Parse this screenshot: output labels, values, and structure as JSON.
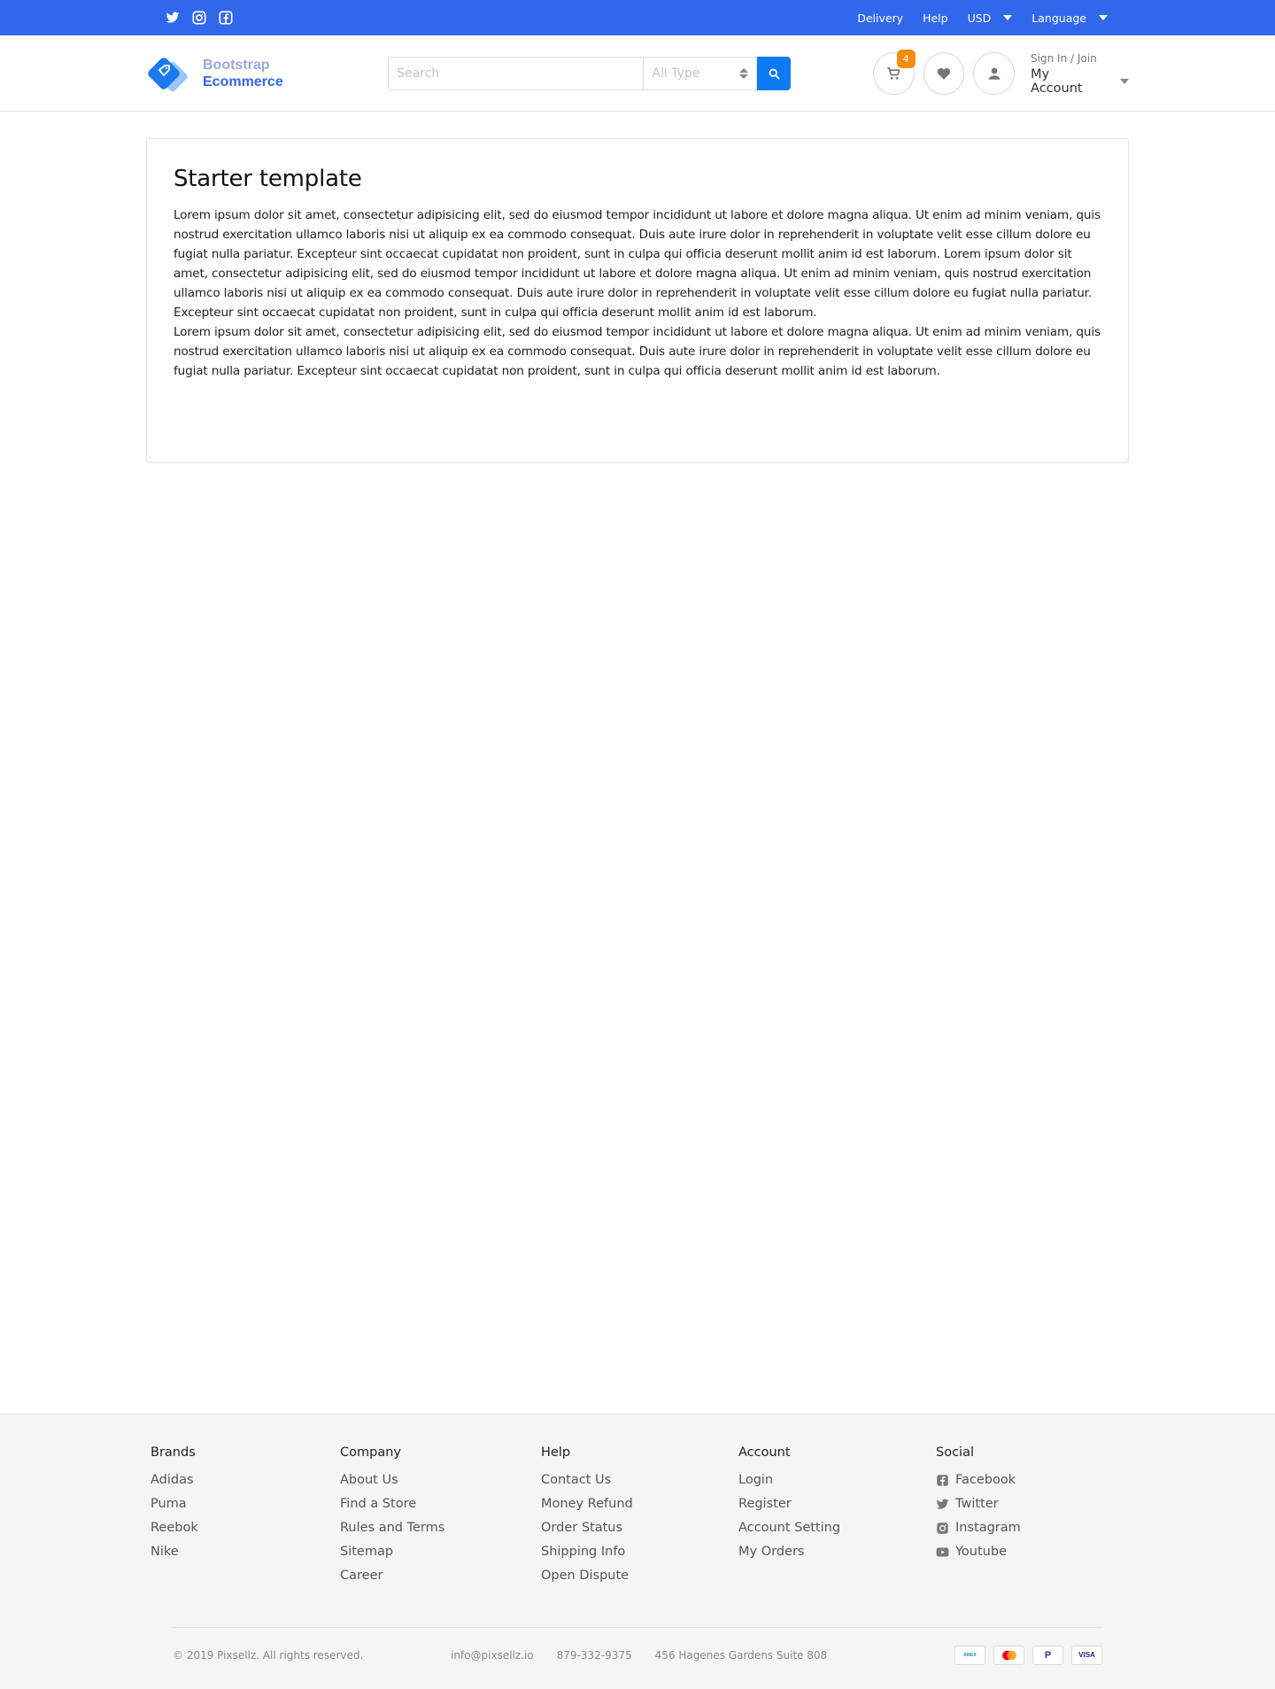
{
  "topbar": {
    "social_icons": [
      "twitter-icon",
      "instagram-icon",
      "facebook-icon"
    ],
    "links": {
      "delivery": "Delivery",
      "help": "Help",
      "currency": "USD",
      "language": "Language"
    }
  },
  "header": {
    "brand": {
      "line1": "Bootstrap",
      "line2": "Ecommerce"
    },
    "search": {
      "placeholder": "Search",
      "type_placeholder": "All Type"
    },
    "cart_count": "4",
    "account": {
      "signin": "Sign In / Join",
      "label": "My Account"
    }
  },
  "main": {
    "title": "Starter template",
    "paragraph1": "Lorem ipsum dolor sit amet, consectetur adipisicing elit, sed do eiusmod tempor incididunt ut labore et dolore magna aliqua. Ut enim ad minim veniam, quis nostrud exercitation ullamco laboris nisi ut aliquip ex ea commodo consequat. Duis aute irure dolor in reprehenderit in voluptate velit esse cillum dolore eu fugiat nulla pariatur. Excepteur sint occaecat cupidatat non proident, sunt in culpa qui officia deserunt mollit anim id est laborum. Lorem ipsum dolor sit amet, consectetur adipisicing elit, sed do eiusmod tempor incididunt ut labore et dolore magna aliqua. Ut enim ad minim veniam, quis nostrud exercitation ullamco laboris nisi ut aliquip ex ea commodo consequat. Duis aute irure dolor in reprehenderit in voluptate velit esse cillum dolore eu fugiat nulla pariatur. Excepteur sint occaecat cupidatat non proident, sunt in culpa qui officia deserunt mollit anim id est laborum.",
    "paragraph2": "Lorem ipsum dolor sit amet, consectetur adipisicing elit, sed do eiusmod tempor incididunt ut labore et dolore magna aliqua. Ut enim ad minim veniam, quis nostrud exercitation ullamco laboris nisi ut aliquip ex ea commodo consequat. Duis aute irure dolor in reprehenderit in voluptate velit esse cillum dolore eu fugiat nulla pariatur. Excepteur sint occaecat cupidatat non proident, sunt in culpa qui officia deserunt mollit anim id est laborum."
  },
  "footer": {
    "brands": {
      "title": "Brands",
      "items": [
        "Adidas",
        "Puma",
        "Reebok",
        "Nike"
      ]
    },
    "company": {
      "title": "Company",
      "items": [
        "About Us",
        "Find a Store",
        "Rules and Terms",
        "Sitemap",
        "Career"
      ]
    },
    "help": {
      "title": "Help",
      "items": [
        "Contact Us",
        "Money Refund",
        "Order Status",
        "Shipping Info",
        "Open Dispute"
      ]
    },
    "account": {
      "title": "Account",
      "items": [
        "Login",
        "Register",
        "Account Setting",
        "My Orders"
      ]
    },
    "social": {
      "title": "Social",
      "items": [
        "Facebook",
        "Twitter",
        "Instagram",
        "Youtube"
      ]
    },
    "copyright": "© 2019 Pixsellz. All rights reserved.",
    "email": "info@pixsellz.io",
    "phone": "879-332-9375",
    "address": "456 Hagenes Gardens Suite 808",
    "payments": [
      "american-express",
      "mastercard",
      "paypal",
      "VISA"
    ]
  },
  "colors": {
    "topbar": "#3167eb",
    "primary_button": "#0d7bf4",
    "badge": "#f58d0a",
    "footer_bg": "#f5f5f5"
  }
}
